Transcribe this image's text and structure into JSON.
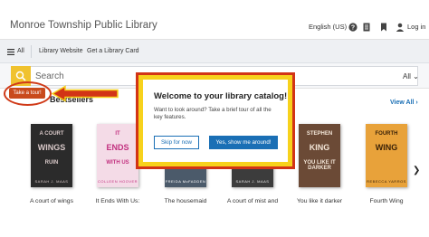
{
  "header": {
    "library_name": "Monroe Township Public Library",
    "language": "English (US)",
    "login": "Log in"
  },
  "nav": {
    "all": "All",
    "library_website": "Library Website",
    "get_card": "Get a Library Card"
  },
  "search": {
    "placeholder": "Search",
    "scope": "All"
  },
  "section": {
    "title": "Bestsellers",
    "view_all": "View All"
  },
  "tour": {
    "button_label": "Take a tour!"
  },
  "modal": {
    "title": "Welcome to your library catalog!",
    "body": "Want to look around? Take a brief tour of all the key features.",
    "skip": "Skip for now",
    "confirm": "Yes, show me around!"
  },
  "books": [
    {
      "title": "A court of wings",
      "cover_line1": "A COURT",
      "cover_line2": "WINGS",
      "cover_line3": "RUIN",
      "author": "SARAH J. MAAS",
      "color": "#2b2b2b",
      "text_color": "#d9c9c9"
    },
    {
      "title": "It Ends With Us:",
      "cover_line1": "IT",
      "cover_line2": "ENDS",
      "cover_line3": "WITH US",
      "author": "COLLEEN HOOVER",
      "color": "#f4dbe7",
      "text_color": "#c2307f"
    },
    {
      "title": "The housemaid",
      "cover_line1": "",
      "cover_line2": "HOUSEMAID",
      "cover_line3": "",
      "author": "FREIDA McFADDEN",
      "color": "#4b5a6a",
      "text_color": "#ffffff"
    },
    {
      "title": "A court of mist and",
      "cover_line1": "",
      "cover_line2": "",
      "cover_line3": "",
      "author": "SARAH J. MAAS",
      "color": "#3c3c3c",
      "text_color": "#e8e8e8"
    },
    {
      "title": "You like it darker",
      "cover_line1": "STEPHEN",
      "cover_line2": "KING",
      "cover_line3": "YOU LIKE IT DARKER",
      "author": "",
      "color": "#6b4a36",
      "text_color": "#f3e6d8"
    },
    {
      "title": "Fourth Wing",
      "cover_line1": "FOURTH",
      "cover_line2": "WING",
      "cover_line3": "",
      "author": "REBECCA YARROS",
      "color": "#e8a23a",
      "text_color": "#3a2208"
    }
  ],
  "colors": {
    "accent_blue": "#1a6fb5",
    "highlight_yellow": "#f7d21c",
    "highlight_red": "#d23416",
    "search_yellow": "#f0c22e"
  },
  "icons": {
    "help": "help-icon",
    "list": "list-icon",
    "bookmark": "bookmark-icon",
    "user": "user-icon",
    "menu": "hamburger-icon",
    "search": "search-icon",
    "next": "chevron-right-icon"
  }
}
